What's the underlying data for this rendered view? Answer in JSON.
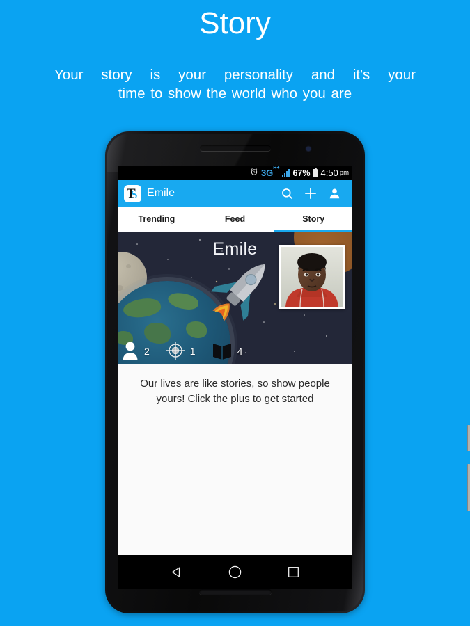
{
  "promo": {
    "title": "Story",
    "subtitle_line1": "Your story is your personality and it's your",
    "subtitle_line2": "time to show the world who you are",
    "background_color": "#0aa3f2",
    "text_color": "#ffffff"
  },
  "phone": {
    "status_bar": {
      "alarm_icon": "alarm-clock-icon",
      "network_type": "3G",
      "network_suffix": "H+",
      "signal_icon": "signal-bars-icon",
      "battery_percent": "67%",
      "battery_icon": "battery-icon",
      "time": "4:50",
      "ampm": "pm",
      "background_color": "#000000",
      "accent_color": "#3ea7e8"
    },
    "app_bar": {
      "logo_letter_1": "T",
      "logo_letter_2": "S",
      "title": "Emile",
      "search_icon": "search-icon",
      "add_icon": "plus-icon",
      "profile_icon": "person-icon",
      "background_color": "#18a9f0"
    },
    "tabs": [
      {
        "label": "Trending",
        "active": false
      },
      {
        "label": "Feed",
        "active": false
      },
      {
        "label": "Story",
        "active": true
      }
    ],
    "tab_indicator_color": "#18a9f0",
    "cover": {
      "name": "Emile",
      "background_color": "#232738",
      "theme": "space",
      "planet_left_icon": "moon-planet-icon",
      "planet_right_icon": "orange-planet-icon",
      "earth_icon": "earth-icon",
      "rocket_icon": "rocket-icon",
      "profile_photo": "profile-photo",
      "stats": [
        {
          "icon": "person-icon",
          "value": "2"
        },
        {
          "icon": "target-icon",
          "value": "1"
        },
        {
          "icon": "open-book-icon",
          "value": "4"
        }
      ]
    },
    "content": {
      "empty_message": "Our lives are like stories, so show people yours! Click the plus to get started",
      "background_color": "#fafafa"
    },
    "nav_bar": {
      "back_icon": "back-triangle-icon",
      "home_icon": "home-circle-icon",
      "recents_icon": "recents-square-icon"
    }
  }
}
